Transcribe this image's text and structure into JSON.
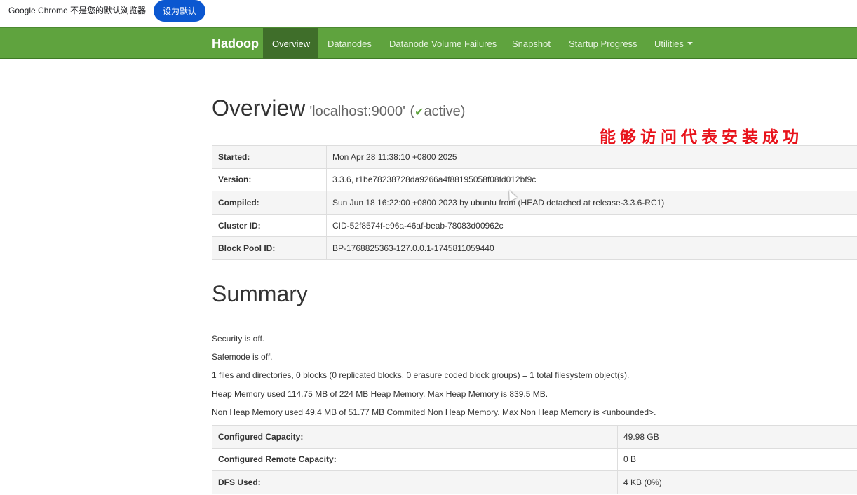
{
  "infobar": {
    "text": "Google Chrome 不是您的默认浏览器",
    "button_label": "设为默认"
  },
  "navbar": {
    "brand": "Hadoop",
    "items": [
      {
        "label": "Overview",
        "active": true
      },
      {
        "label": "Datanodes"
      },
      {
        "label": "Datanode Volume Failures"
      },
      {
        "label": "Snapshot"
      },
      {
        "label": "Startup Progress"
      },
      {
        "label": "Utilities"
      }
    ],
    "accent_color": "#5fa33e",
    "active_color": "#3f6e2a"
  },
  "overview": {
    "title": "Overview",
    "host": "'localhost:9000'",
    "state_open": "(",
    "check_icon": "✔",
    "state": "active)",
    "rows": [
      {
        "key": "Started:",
        "value": "Mon Apr 28 11:38:10 +0800 2025"
      },
      {
        "key": "Version:",
        "value": "3.3.6, r1be78238728da9266a4f88195058f08fd012bf9c"
      },
      {
        "key": "Compiled:",
        "value": "Sun Jun 18 16:22:00 +0800 2023 by ubuntu from (HEAD detached at release-3.3.6-RC1)"
      },
      {
        "key": "Cluster ID:",
        "value": "CID-52f8574f-e96a-46af-beab-78083d00962c"
      },
      {
        "key": "Block Pool ID:",
        "value": "BP-1768825363-127.0.0.1-1745811059440"
      }
    ]
  },
  "annotation": {
    "text": "能够访问代表安装成功",
    "color": "#e8131b"
  },
  "summary": {
    "title": "Summary",
    "lines": [
      "Security is off.",
      "Safemode is off.",
      "1 files and directories, 0 blocks (0 replicated blocks, 0 erasure coded block groups) = 1 total filesystem object(s).",
      "Heap Memory used 114.75 MB of 224 MB Heap Memory. Max Heap Memory is 839.5 MB.",
      "Non Heap Memory used 49.4 MB of 51.77 MB Commited Non Heap Memory. Max Non Heap Memory is <unbounded>."
    ],
    "rows": [
      {
        "key": "Configured Capacity:",
        "value": "49.98 GB"
      },
      {
        "key": "Configured Remote Capacity:",
        "value": "0 B"
      },
      {
        "key": "DFS Used:",
        "value": "4 KB (0%)"
      }
    ]
  }
}
